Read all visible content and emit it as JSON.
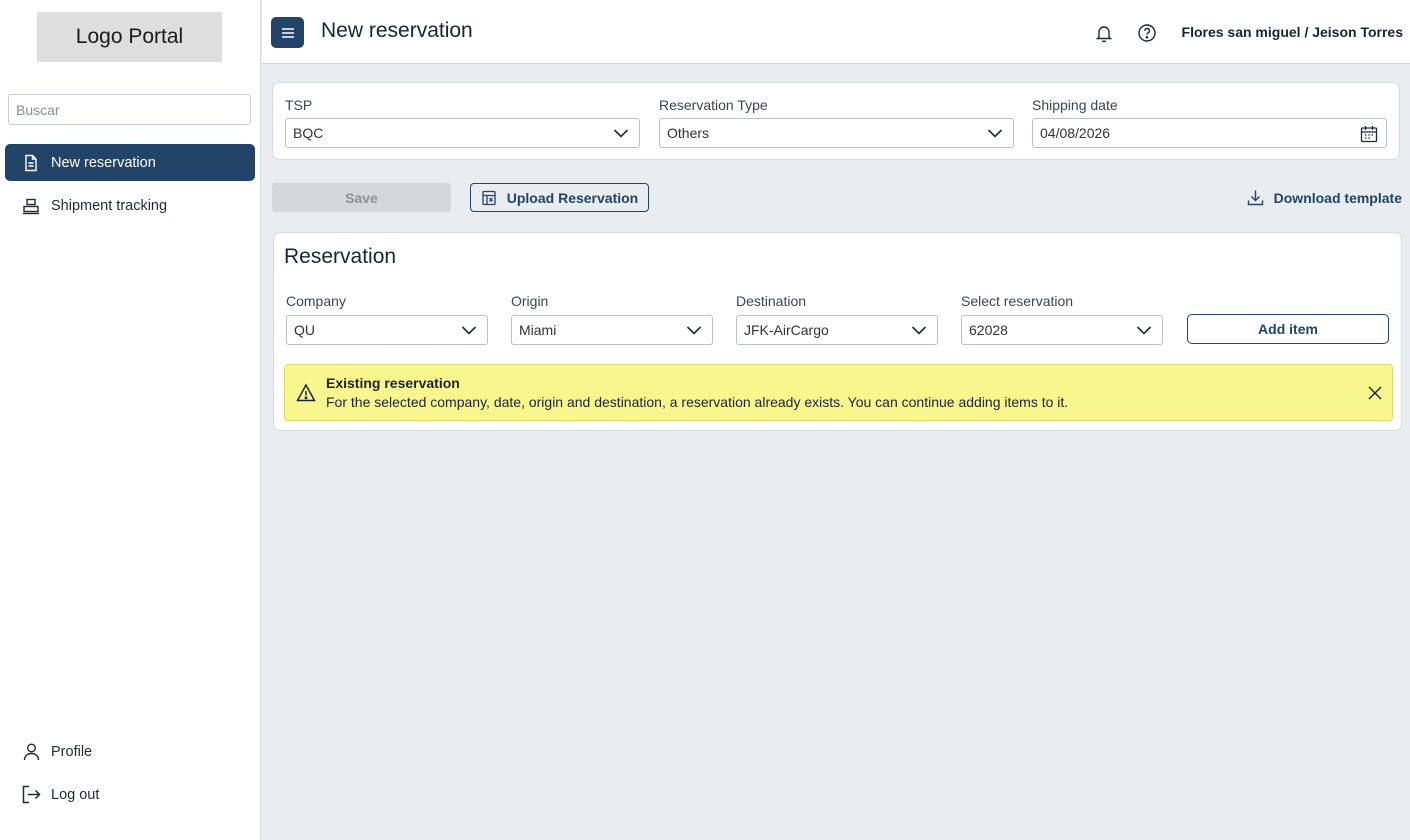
{
  "sidebar": {
    "logo": "Logo Portal",
    "search_placeholder": "Buscar",
    "nav": [
      {
        "label": "New reservation",
        "icon": "document-icon",
        "active": true
      },
      {
        "label": "Shipment tracking",
        "icon": "boxes-icon",
        "active": false
      }
    ],
    "bottom": [
      {
        "label": "Profile",
        "icon": "user-icon"
      },
      {
        "label": "Log out",
        "icon": "logout-icon"
      }
    ]
  },
  "header": {
    "title": "New reservation",
    "user": "Flores san miguel / Jeison Torres",
    "icons": [
      "menu-icon",
      "bell-icon",
      "help-icon"
    ]
  },
  "filters": {
    "tsp": {
      "label": "TSP",
      "value": "BQC"
    },
    "reservation_type": {
      "label": "Reservation Type",
      "value": "Others"
    },
    "shipping_date": {
      "label": "Shipping date",
      "value": "04/08/2026"
    }
  },
  "actions": {
    "save": "Save",
    "upload": "Upload Reservation",
    "download": "Download template"
  },
  "reservation": {
    "title": "Reservation",
    "company": {
      "label": "Company",
      "value": "QU"
    },
    "origin": {
      "label": "Origin",
      "value": "Miami"
    },
    "destination": {
      "label": "Destination",
      "value": "JFK-AirCargo"
    },
    "select_reservation": {
      "label": "Select reservation",
      "value": "62028"
    },
    "add_item": "Add item"
  },
  "alert": {
    "title": "Existing reservation",
    "message": "For the selected company, date, origin and destination, a reservation already exists. You can continue adding items to it."
  },
  "colors": {
    "primary": "#214468",
    "background": "#e9edf0",
    "alert_bg": "#f9f68e"
  }
}
